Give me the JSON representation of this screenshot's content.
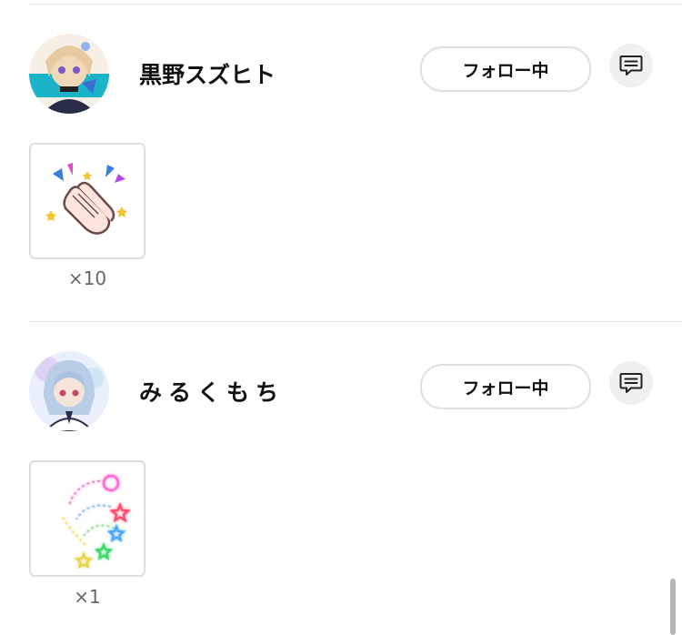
{
  "users": [
    {
      "name": "黒野スズヒト",
      "follow_label": "フォロー中",
      "avatar_colors": [
        "#f3e7d8",
        "#1ab3c8",
        "#e9c9a0"
      ],
      "gift": {
        "icon": "clapping-hands-icon",
        "count": "×10"
      }
    },
    {
      "name": "みるくもち",
      "follow_label": "フォロー中",
      "avatar_colors": [
        "#eaf2fb",
        "#c8d9ef",
        "#b9a6e6"
      ],
      "gift": {
        "icon": "shooting-stars-icon",
        "count": "×1"
      }
    }
  ],
  "colors": {
    "divider": "#e6e6e6",
    "button_border": "#e0e0e0",
    "message_button_bg": "#f0f0f0",
    "count_text": "#666666"
  }
}
